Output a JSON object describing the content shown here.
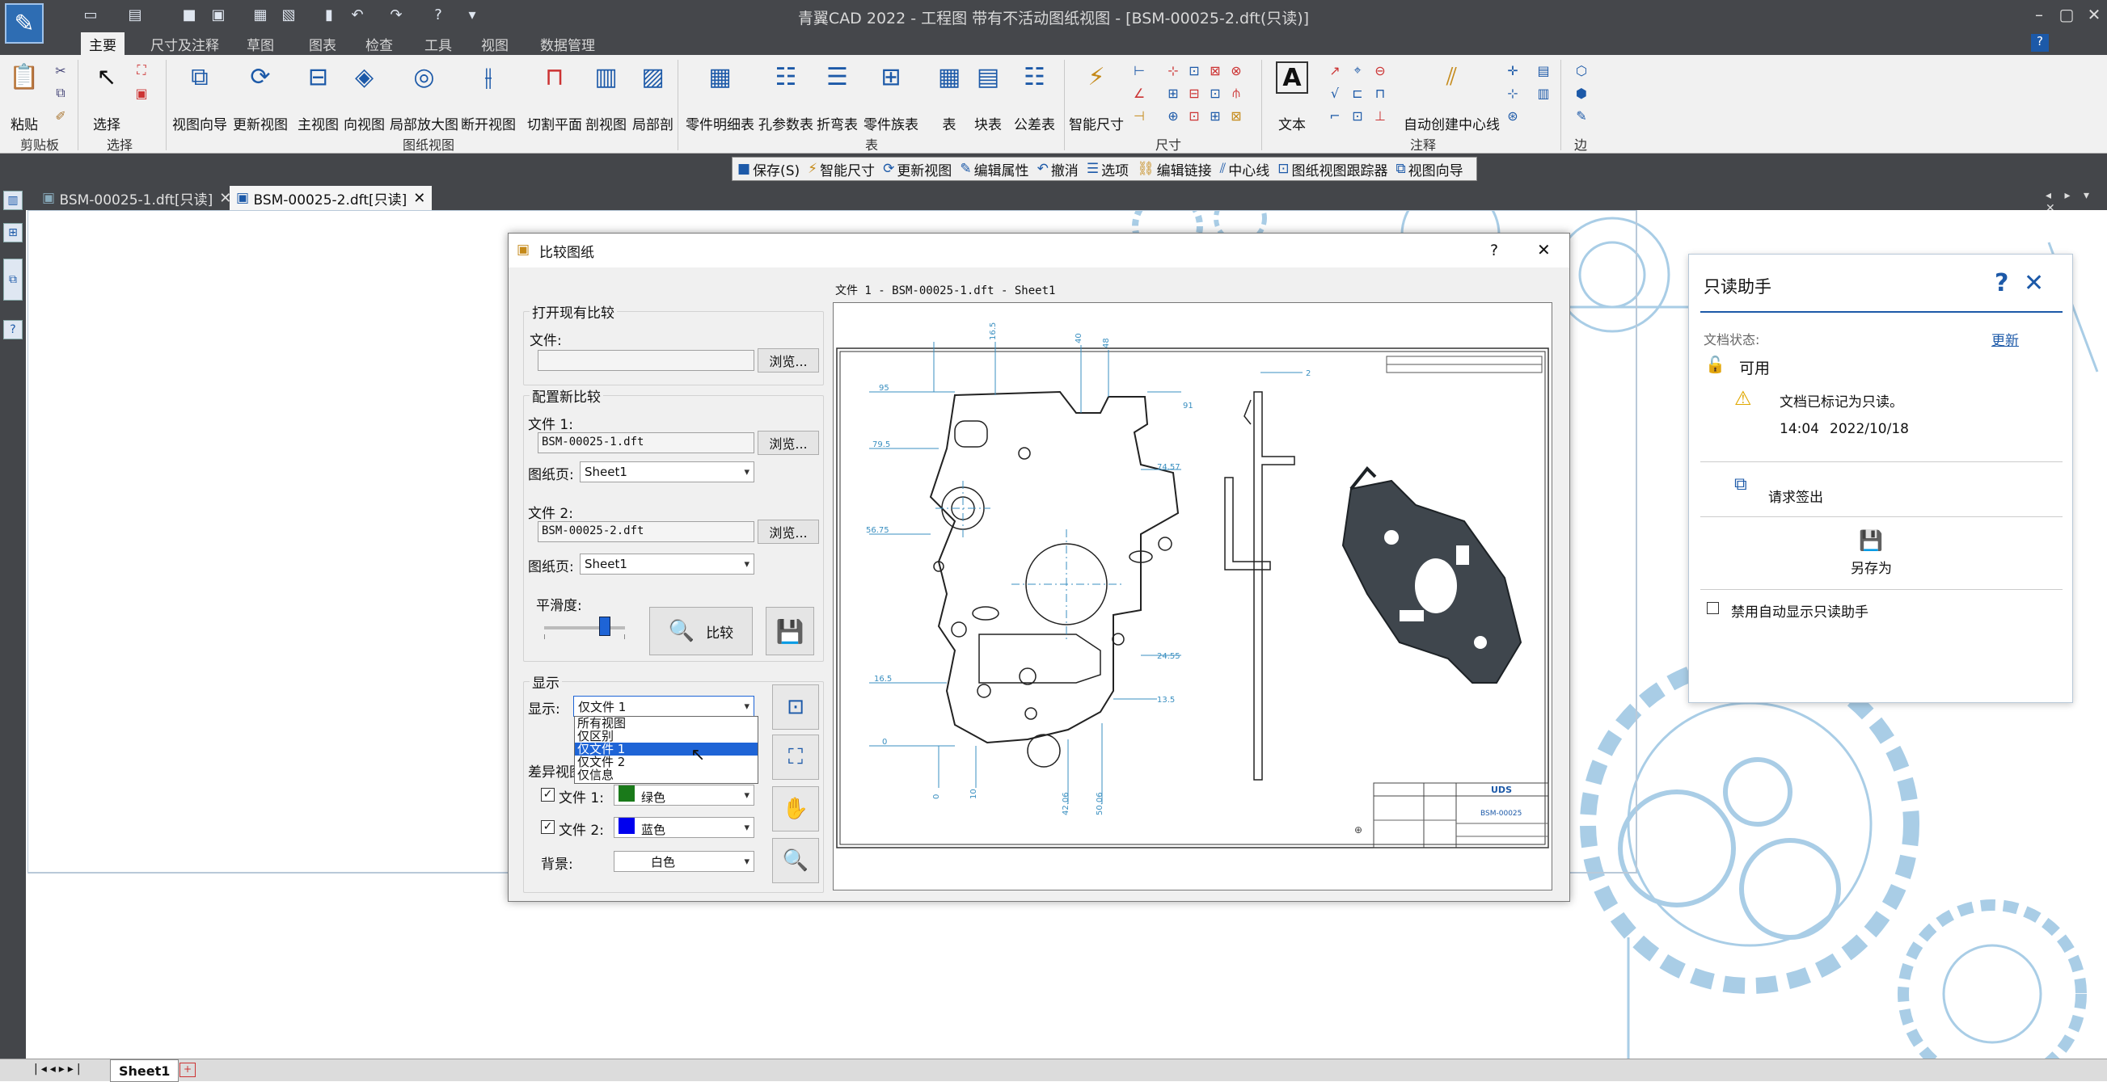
{
  "app": {
    "window_title": "青翼CAD 2022 - 工程图 带有不活动图纸视图 - [BSM-00025-2.dft(只读)]"
  },
  "ribbon_tabs": [
    "主要",
    "尺寸及注释",
    "草图",
    "图表",
    "检查",
    "工具",
    "视图",
    "数据管理"
  ],
  "ribbon": {
    "clipboard": {
      "paste": "粘贴",
      "group": "剪贴板"
    },
    "select": {
      "select": "选择",
      "group": "选择"
    },
    "drawing_views": {
      "buttons": [
        "视图向导",
        "更新视图",
        "主视图",
        "向视图",
        "局部放大图",
        "断开视图",
        "切割平面",
        "剖视图",
        "局部剖"
      ],
      "group": "图纸视图"
    },
    "tables": {
      "buttons": [
        "零件明细表",
        "孔参数表",
        "折弯表",
        "零件族表",
        "表",
        "块表",
        "公差表"
      ],
      "group": "表"
    },
    "dimension": {
      "smart_dim": "智能尺寸",
      "group": "尺寸"
    },
    "annotation": {
      "text": "文本",
      "auto_centerline": "自动创建中心线",
      "group": "注释"
    },
    "edge": {
      "group": "边"
    }
  },
  "command_bar": [
    "保存(S)",
    "智能尺寸",
    "更新视图",
    "编辑属性",
    "撤消",
    "选项",
    "编辑链接",
    "中心线",
    "图纸视图跟踪器",
    "视图向导"
  ],
  "doc_tabs": [
    {
      "label": "BSM-00025-1.dft[只读]"
    },
    {
      "label": "BSM-00025-2.dft[只读]"
    }
  ],
  "sheet_tab": "Sheet1",
  "dialog": {
    "title": "比较图纸",
    "open_existing": {
      "group": "打开现有比较",
      "file_label": "文件:",
      "file_value": "",
      "browse": "浏览..."
    },
    "new_compare": {
      "group": "配置新比较",
      "file1_label": "文件 1:",
      "file1_value": "BSM-00025-1.dft",
      "browse1": "浏览...",
      "sheet1_label": "图纸页:",
      "sheet1_value": "Sheet1",
      "file2_label": "文件 2:",
      "file2_value": "BSM-00025-2.dft",
      "browse2": "浏览...",
      "sheet2_label": "图纸页:",
      "sheet2_value": "Sheet1",
      "smooth_label": "平滑度:",
      "smoothness": 0.75,
      "compare_button": "比较"
    },
    "display": {
      "group": "显示",
      "show_label": "显示:",
      "show_value": "仅文件 1",
      "options": [
        "所有视图",
        "仅区别",
        "仅文件 1",
        "仅文件 2",
        "仅信息"
      ],
      "selected_index": 2,
      "diff_group": "差异视图",
      "file1_label": "文件 1:",
      "file1_color": "绿色",
      "file1_hex": "#1a7a1a",
      "file2_label": "文件 2:",
      "file2_color": "蓝色",
      "file2_hex": "#0000ee",
      "bg_label": "背景:",
      "bg_value": "白色"
    },
    "preview_title": "文件 1 - BSM-00025-1.dft - Sheet1",
    "preview_dims": [
      "95",
      "79.5",
      "56.75",
      "16.5",
      "0",
      "16.5",
      "40",
      "48",
      "91",
      "74.57",
      "24.55",
      "13.5",
      "0",
      "10",
      "42.06",
      "50.06",
      "2"
    ],
    "title_block": {
      "company": "UDS",
      "part_no": "BSM-00025"
    }
  },
  "readonly_panel": {
    "title": "只读助手",
    "doc_status_label": "文档状态:",
    "refresh": "更新",
    "status": "可用",
    "message": "文档已标记为只读。",
    "time": "14:04",
    "date": "2022/10/18",
    "checkout": "请求签出",
    "save_as": "另存为",
    "disable_auto": "禁用自动显示只读助手"
  },
  "colors": {
    "accent": "#1c59a8",
    "dim_line": "#3a8fc0",
    "selection": "#1e64d6"
  }
}
